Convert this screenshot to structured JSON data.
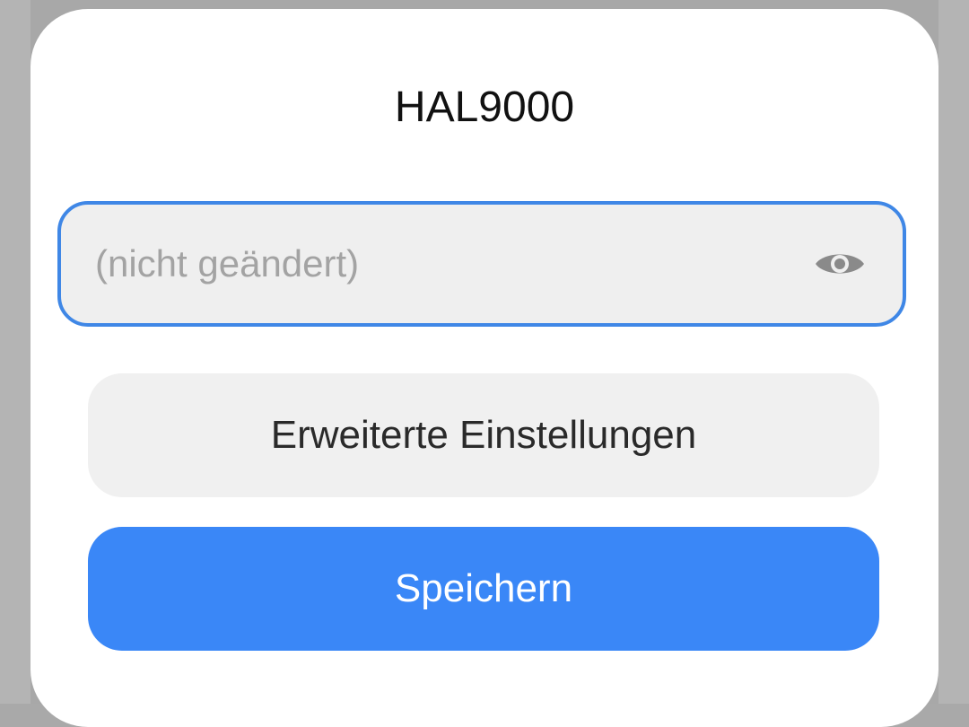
{
  "dialog": {
    "title": "HAL9000",
    "password": {
      "value": "",
      "placeholder": "(nicht geändert)",
      "toggle_icon": "eye-icon"
    },
    "advanced_button_label": "Erweiterte Einstellungen",
    "save_button_label": "Speichern"
  },
  "colors": {
    "accent": "#3a87f7",
    "field_border": "#3f87e6",
    "field_background": "#efefef",
    "secondary_button": "#f0f0f0",
    "scrim": "#a8a8a8"
  }
}
